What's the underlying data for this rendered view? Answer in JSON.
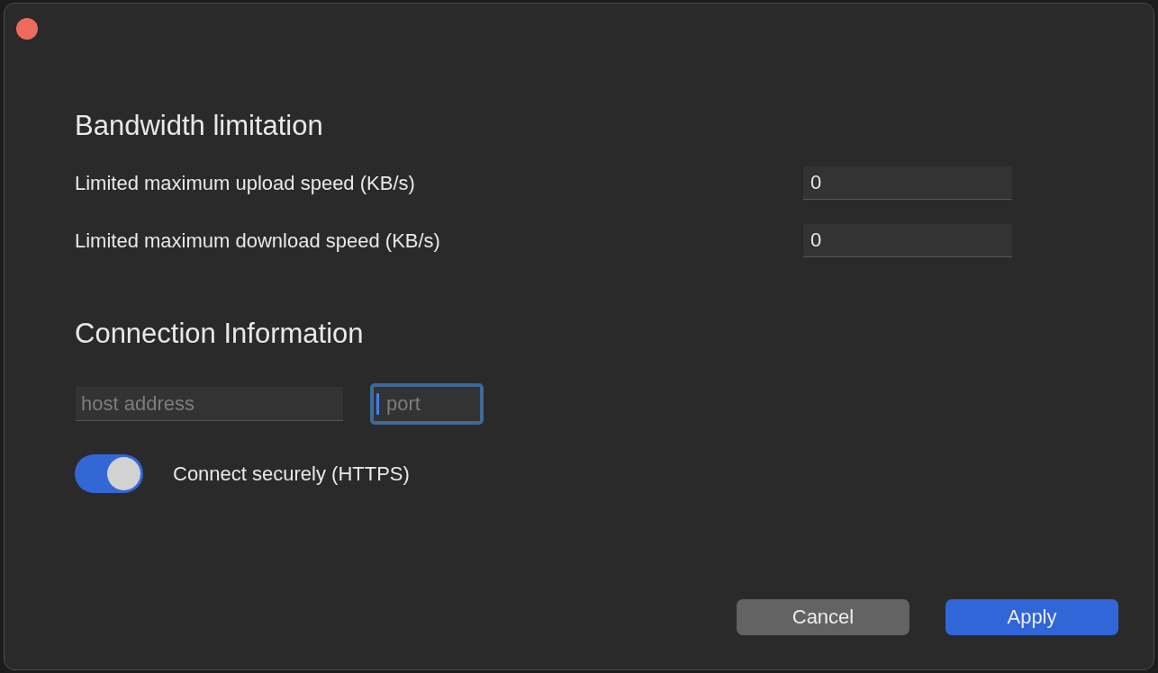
{
  "bandwidth": {
    "title": "Bandwidth limitation",
    "fields": [
      {
        "label": "Limited maximum upload speed (KB/s)",
        "value": "0"
      },
      {
        "label": "Limited maximum download speed (KB/s)",
        "value": "0"
      }
    ]
  },
  "connection": {
    "title": "Connection Information",
    "host": {
      "placeholder": "host address",
      "focused": false
    },
    "port": {
      "placeholder": "port",
      "focused": true
    },
    "secure": {
      "label": "Connect securely (HTTPS)",
      "on": true
    }
  },
  "buttons": [
    {
      "label": "Cancel",
      "kind": "secondary"
    },
    {
      "label": "Apply",
      "kind": "primary"
    }
  ]
}
